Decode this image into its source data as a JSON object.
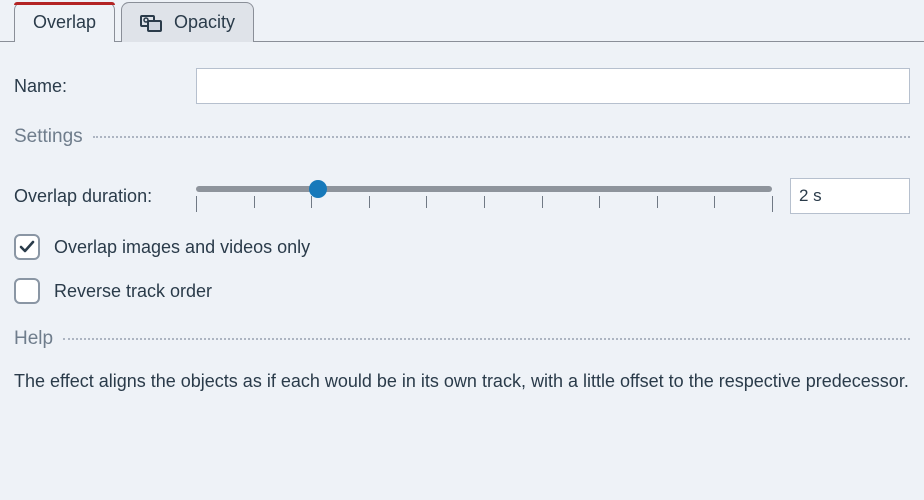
{
  "tabs": {
    "overlap": {
      "label": "Overlap"
    },
    "opacity": {
      "label": "Opacity"
    }
  },
  "fields": {
    "name_label": "Name:",
    "name_value": ""
  },
  "sections": {
    "settings": "Settings",
    "help": "Help"
  },
  "overlap_duration": {
    "label": "Overlap duration:",
    "value_display": "2 s",
    "slider_percent": 21.2
  },
  "checkboxes": {
    "images_videos_only": {
      "label": "Overlap images and videos only",
      "checked": true
    },
    "reverse_order": {
      "label": "Reverse track order",
      "checked": false
    }
  },
  "help_text": "The effect aligns the objects as if each would be in its own track, with a little offset to the respective predecessor."
}
